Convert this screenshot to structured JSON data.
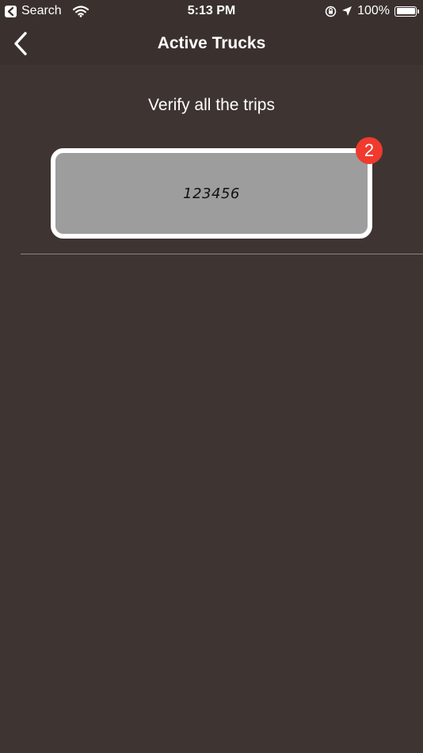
{
  "status_bar": {
    "back_app_label": "Search",
    "time": "5:13 PM",
    "battery_percent": "100%",
    "battery_level": 1.0,
    "icons": [
      "back-app-icon",
      "wifi-icon",
      "orientation-lock-icon",
      "location-arrow-icon",
      "battery-icon"
    ]
  },
  "nav": {
    "title": "Active Trucks",
    "back_icon": "chevron-left-icon"
  },
  "main": {
    "subtitle": "Verify all the trips",
    "trucks": [
      {
        "number": "123456",
        "badge_count": "2"
      }
    ]
  },
  "colors": {
    "background": "#3e3532",
    "card_fill": "#9d9d9d",
    "card_border": "#ffffff",
    "badge": "#f03a2e"
  }
}
